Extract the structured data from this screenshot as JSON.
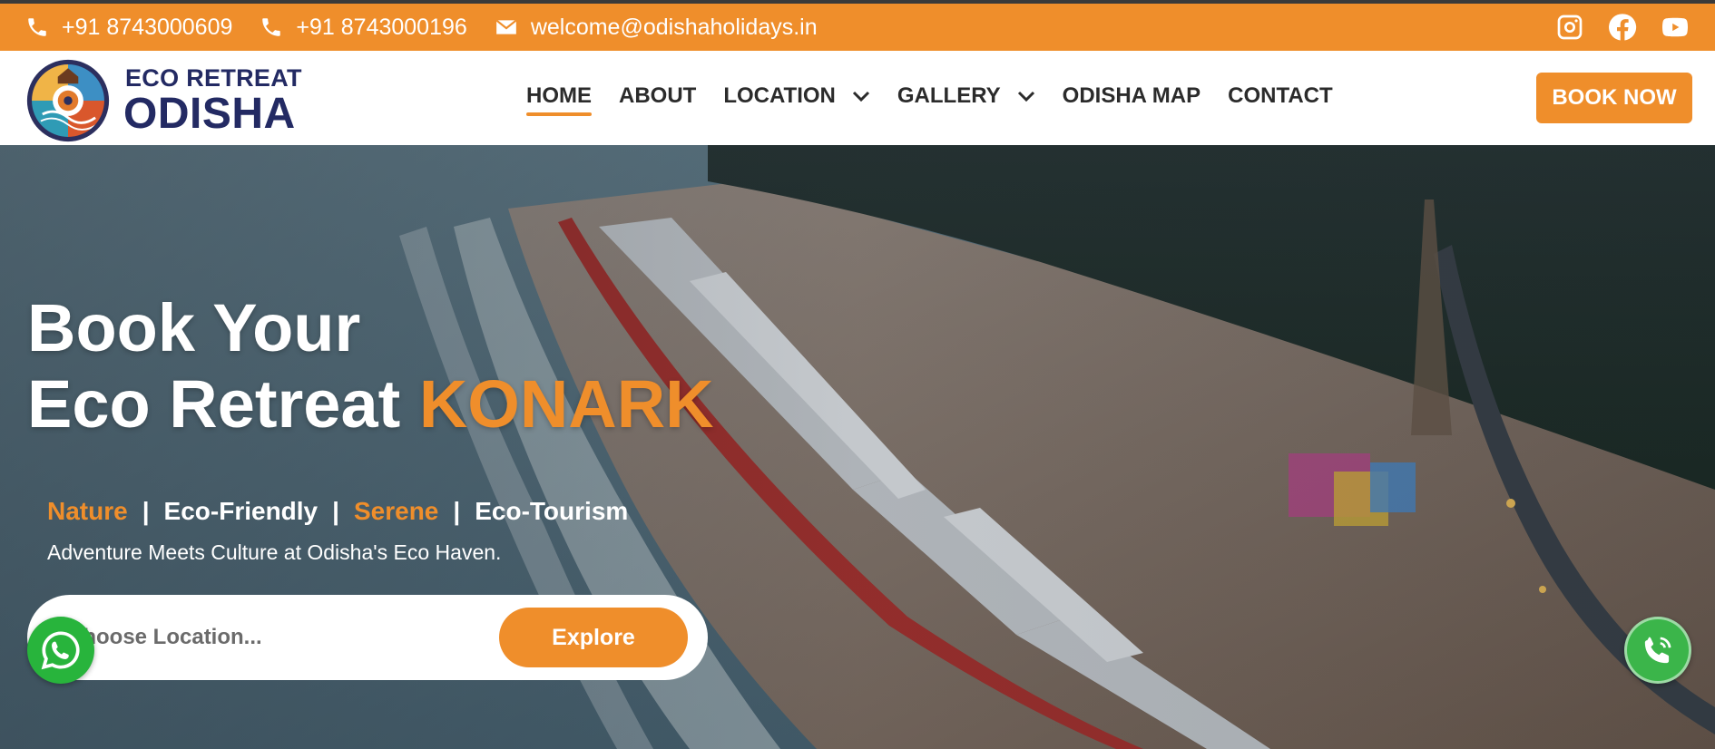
{
  "topbar": {
    "phone1": "+91 8743000609",
    "phone2": "+91 8743000196",
    "email": "welcome@odishaholidays.in",
    "socials": [
      "instagram-icon",
      "facebook-icon",
      "youtube-icon"
    ]
  },
  "logo": {
    "line1": "ECO RETREAT",
    "line2": "ODISHA"
  },
  "nav": {
    "items": [
      {
        "label": "HOME",
        "active": true
      },
      {
        "label": "ABOUT"
      },
      {
        "label": "LOCATION",
        "dropdown": true
      },
      {
        "label": "GALLERY",
        "dropdown": true
      },
      {
        "label": "ODISHA MAP"
      },
      {
        "label": "CONTACT"
      }
    ],
    "book_now": "BOOK NOW"
  },
  "hero": {
    "title_line1": "Book Your",
    "title_line2_prefix": "Eco Retreat",
    "title_line2_accent": "KONARK",
    "tags": [
      "Nature",
      "Eco-Friendly",
      "Serene",
      "Eco-Tourism"
    ],
    "separator": "|",
    "subline": "Adventure Meets Culture at Odisha's Eco Haven.",
    "search": {
      "placeholder": "Choose Location...",
      "button_label": "Explore"
    }
  },
  "colors": {
    "accent": "#ef8e2b",
    "brand_navy": "#232a63",
    "whatsapp": "#28b43c",
    "call": "#3bb54a"
  }
}
